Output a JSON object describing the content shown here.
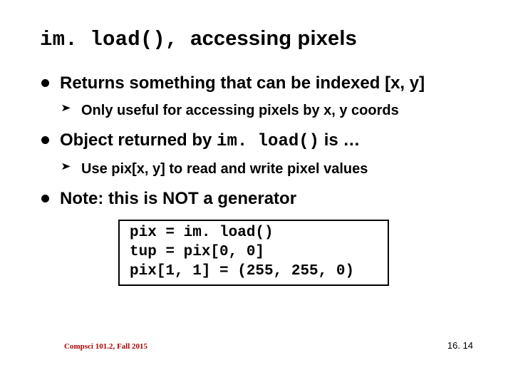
{
  "title": {
    "code": "im. load(), ",
    "rest": "accessing pixels"
  },
  "bullets": {
    "b1": "Returns something that can be indexed [x, y]",
    "b1_sub": "Only useful for accessing pixels by x, y coords",
    "b2_pre": "Object returned by ",
    "b2_code": "im. load()",
    "b2_post": " is …",
    "b2_sub": "Use pix[x, y] to read and write pixel values",
    "b3": "Note: this is NOT a generator"
  },
  "codebox": "pix = im. load()\ntup = pix[0, 0]\npix[1, 1] = (255, 255, 0)",
  "footer": {
    "left": "Compsci 101.2, Fall 2015",
    "right": "16. 14"
  }
}
